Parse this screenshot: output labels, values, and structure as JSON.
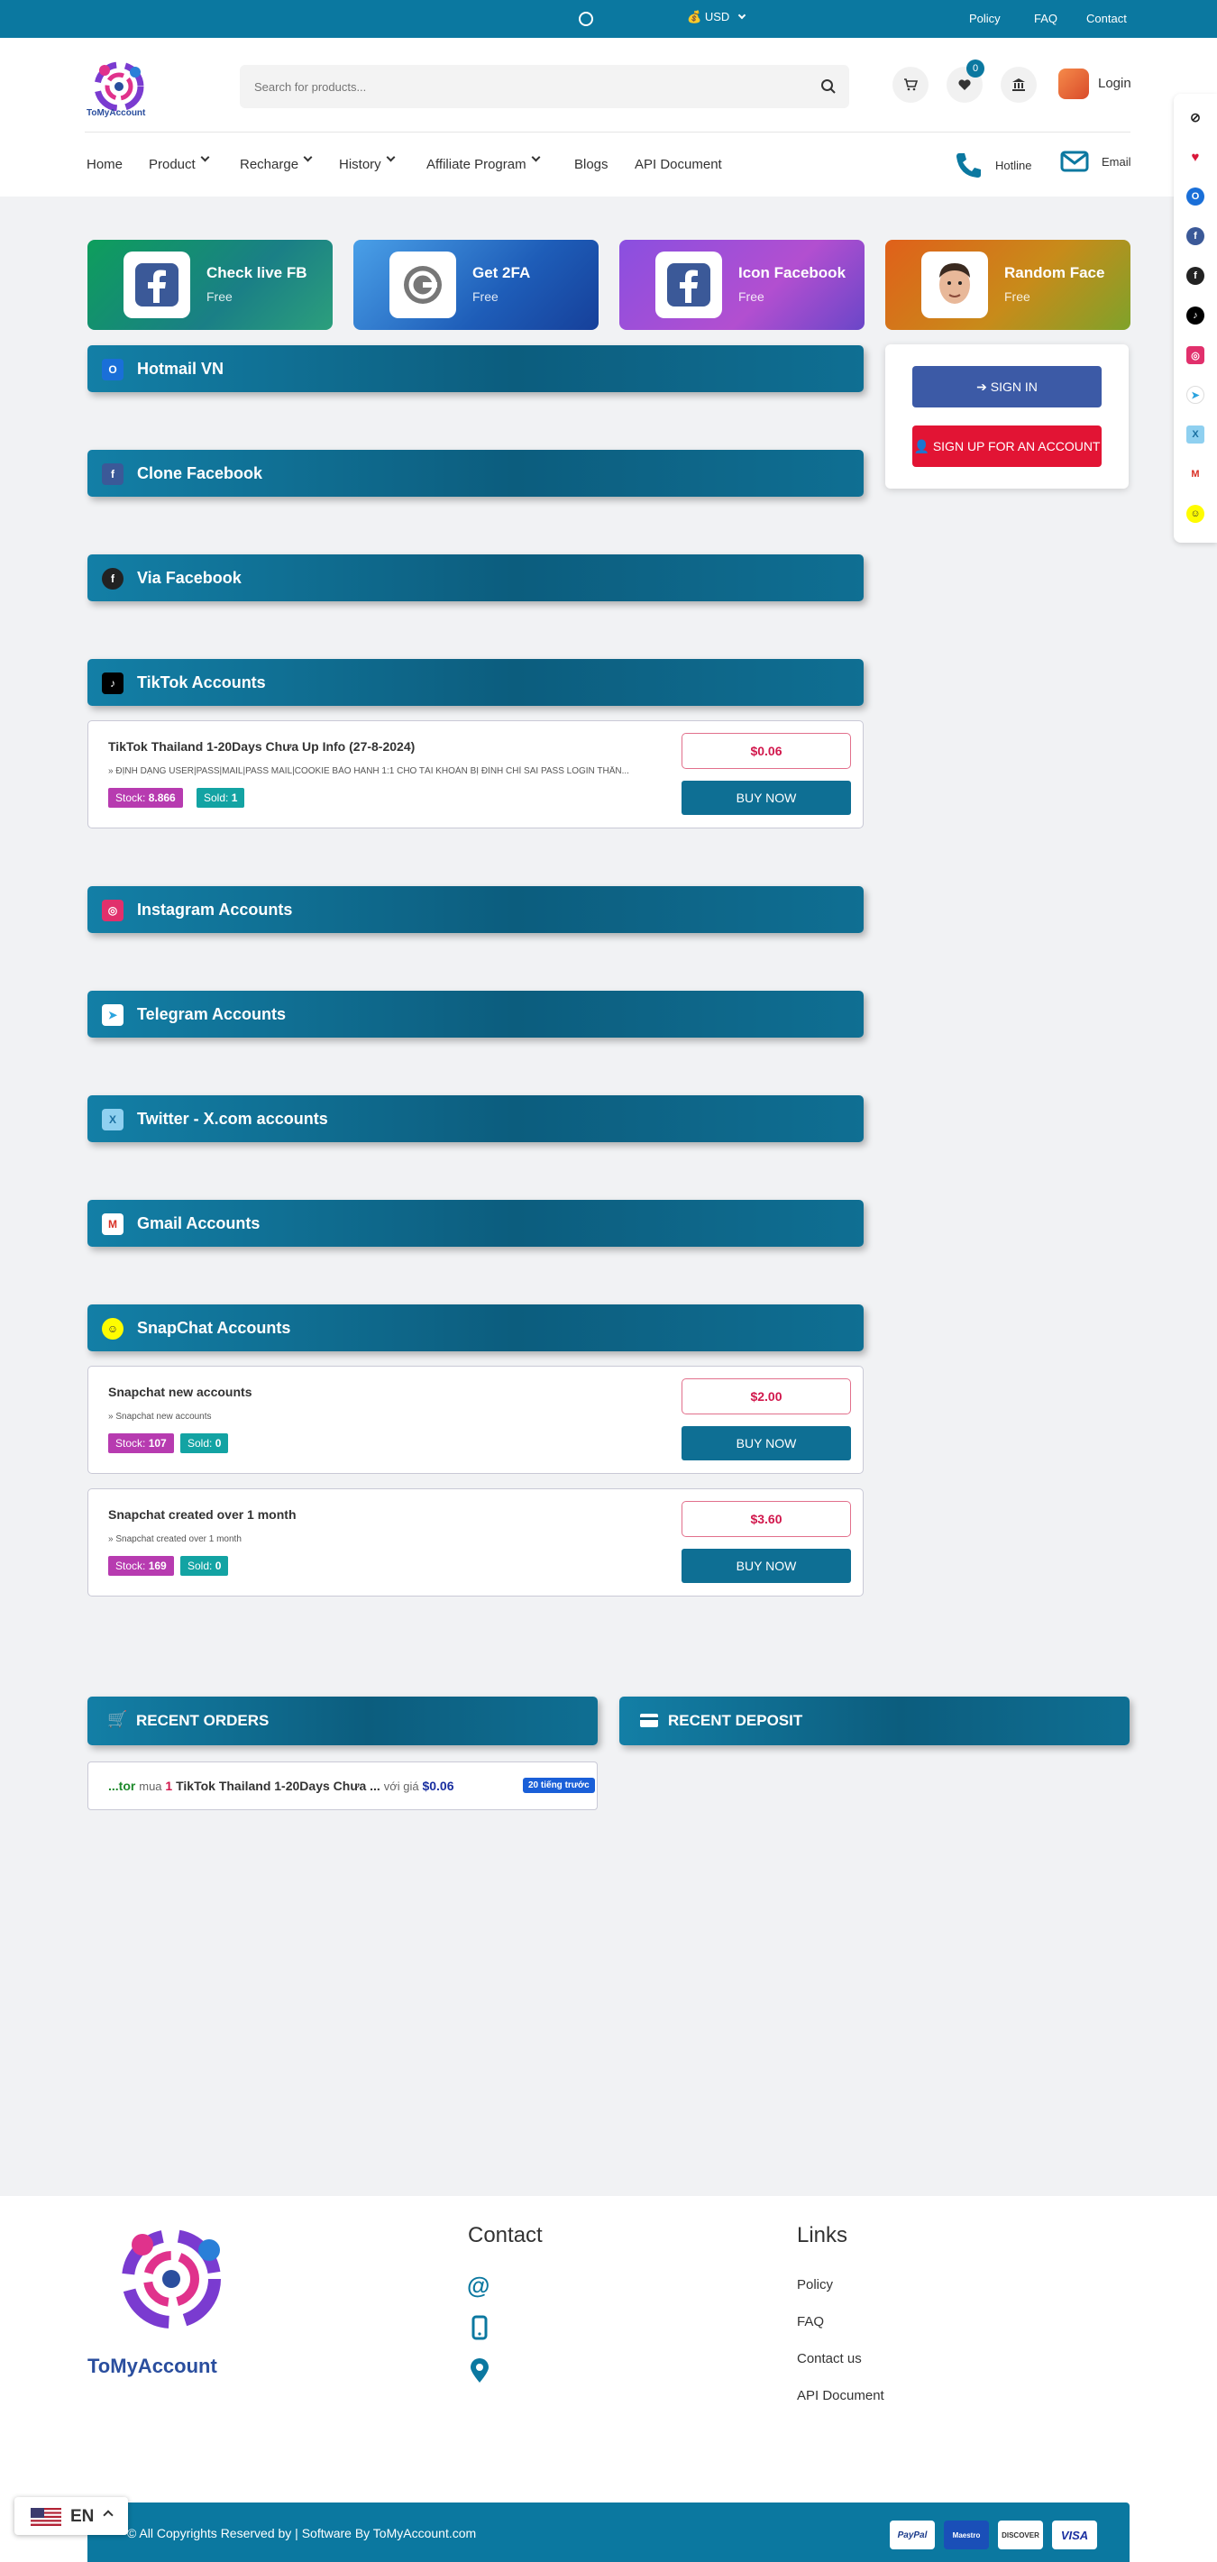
{
  "topbar": {
    "currency": "USD",
    "links": [
      "Policy",
      "FAQ",
      "Contact"
    ]
  },
  "brand": {
    "name": "ToMyAccount"
  },
  "search": {
    "placeholder": "Search for products..."
  },
  "header": {
    "wishlist_count": "0",
    "login_label": "Login"
  },
  "nav": {
    "items": [
      "Home",
      "Product",
      "Recharge",
      "History",
      "Affiliate Program",
      "Blogs",
      "API Document"
    ],
    "hotline": "Hotline",
    "email": "Email"
  },
  "tools": [
    {
      "title": "Check live FB",
      "sub": "Free",
      "icon": "facebook-icon",
      "color": "#14a77a"
    },
    {
      "title": "Get 2FA",
      "sub": "Free",
      "icon": "2fa-icon",
      "color": "#2f80d8"
    },
    {
      "title": "Icon Facebook",
      "sub": "Free",
      "icon": "facebook-icon",
      "color": "#a646d8"
    },
    {
      "title": "Random Face",
      "sub": "Free",
      "icon": "face-icon",
      "color": "#e26a1e"
    }
  ],
  "auth": {
    "sign_in": "SIGN IN",
    "sign_up": "SIGN UP FOR AN ACCOUNT"
  },
  "categories": [
    {
      "title": "Hotmail VN",
      "icon": "outlook-icon"
    },
    {
      "title": "Clone Facebook",
      "icon": "facebook-icon"
    },
    {
      "title": "Via Facebook",
      "icon": "facebook-icon"
    },
    {
      "title": "TikTok Accounts",
      "icon": "tiktok-icon"
    },
    {
      "title": "Instagram Accounts",
      "icon": "instagram-icon"
    },
    {
      "title": "Telegram Accounts",
      "icon": "telegram-icon"
    },
    {
      "title": "Twitter - X.com accounts",
      "icon": "twitter-icon"
    },
    {
      "title": "Gmail Accounts",
      "icon": "gmail-icon"
    },
    {
      "title": "SnapChat Accounts",
      "icon": "snapchat-icon"
    }
  ],
  "products": [
    {
      "name": "TikTok Thailand 1-20Days Chưa Up Info (27-8-2024)",
      "desc": "ĐỊNH DẠNG USER|PASS|MAIL|PASS MAIL|COOKIE BẢO HÀNH 1:1 CHO TÀI KHOẢN BỊ ĐÌNH CHỈ SAI PASS LOGIN THẤN...",
      "stock_label": "Stock:",
      "stock": "8.866",
      "sold_label": "Sold:",
      "sold": "1",
      "price": "$0.06",
      "buy": "BUY NOW"
    },
    {
      "name": "Snapchat new accounts",
      "desc": "Snapchat new accounts",
      "stock_label": "Stock:",
      "stock": "107",
      "sold_label": "Sold:",
      "sold": "0",
      "price": "$2.00",
      "buy": "BUY NOW"
    },
    {
      "name": "Snapchat created over 1 month",
      "desc": "Snapchat created over 1 month",
      "stock_label": "Stock:",
      "stock": "169",
      "sold_label": "Sold:",
      "sold": "0",
      "price": "$3.60",
      "buy": "BUY NOW"
    }
  ],
  "recent": {
    "orders_title": "RECENT ORDERS",
    "deposit_title": "RECENT DEPOSIT",
    "order": {
      "user": "...tor",
      "verb": "mua",
      "qty": "1",
      "product": "TikTok Thailand 1-20Days Chưa ...",
      "with_price": "với giá",
      "price": "$0.06",
      "time": "20 tiếng trước"
    }
  },
  "footer": {
    "contact_title": "Contact",
    "links_title": "Links",
    "links": [
      "Policy",
      "FAQ",
      "Contact us",
      "API Document"
    ],
    "copyright": "© All Copyrights Reserved by  | Software By ToMyAccount.com",
    "payments": [
      "PayPal",
      "Maestro",
      "DISCOVER",
      "VISA"
    ]
  },
  "language": {
    "code": "EN"
  }
}
